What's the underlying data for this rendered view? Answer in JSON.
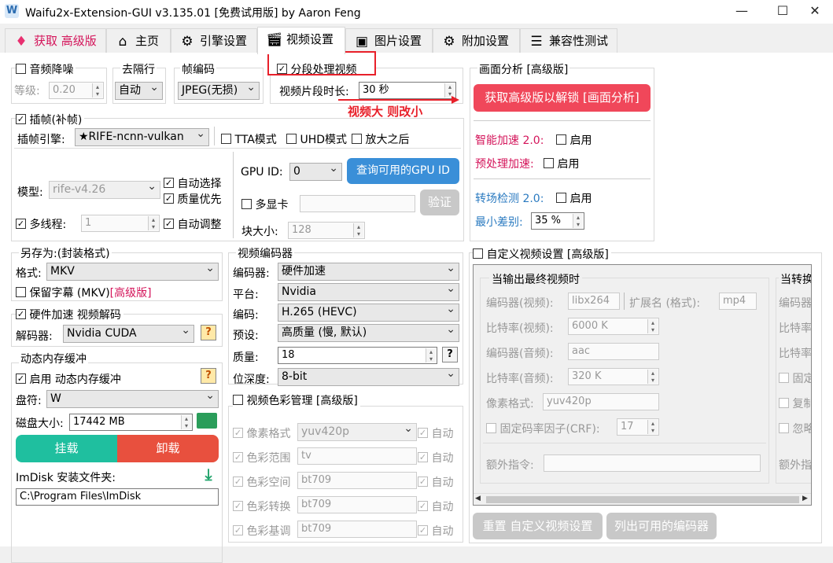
{
  "window": {
    "title": "Waifu2x-Extension-GUI v3.135.01 [免费试用版] by Aaron Feng",
    "app_icon": "W",
    "minimize": "—",
    "maximize": "☐",
    "close": "✕"
  },
  "tabs": [
    {
      "label": "获取 高级版",
      "icon": "diamond-icon"
    },
    {
      "label": "主页",
      "icon": "home-icon"
    },
    {
      "label": "引擎设置",
      "icon": "gear-icon"
    },
    {
      "label": "视频设置",
      "icon": "clapperboard-icon"
    },
    {
      "label": "图片设置",
      "icon": "image-icon"
    },
    {
      "label": "附加设置",
      "icon": "gear-icon"
    },
    {
      "label": "兼容性测试",
      "icon": "checklist-icon"
    }
  ],
  "denoise": {
    "title": "音频降噪",
    "level_label": "等级:",
    "level_value": "0.20"
  },
  "deinterlace": {
    "title": "去隔行",
    "value": "自动"
  },
  "frame_codec": {
    "title": "帧编码",
    "value": "JPEG(无损)"
  },
  "segment": {
    "title": "分段处理视频",
    "checked": true,
    "len_label": "视频片段时长:",
    "len_value": "30 秒",
    "annotation": "视频大 则改小"
  },
  "interp": {
    "title": "插帧(补帧)",
    "engine_label": "插帧引擎:",
    "engine_value": "★RIFE-ncnn-vulkan",
    "tta": "TTA模式",
    "uhd": "UHD模式",
    "after": "放大之后",
    "model_label": "模型:",
    "model_value": "rife-v4.26",
    "auto_select": "自动选择",
    "quality_first": "质量优先",
    "auto_adjust": "自动调整",
    "multithread_label": "多线程:",
    "multithread_value": "1",
    "gpu_label": "GPU ID:",
    "gpu_value": "0",
    "query_gpu": "查询可用的GPU ID",
    "multi_gpu": "多显卡",
    "verify": "验证",
    "tile_label": "块大小:",
    "tile_value": "128"
  },
  "analysis": {
    "title": "画面分析 [高级版]",
    "unlock": "获取高级版以解锁 [画面分析]",
    "smart_accel": "智能加速 2.0:",
    "pre_accel": "预处理加速:",
    "scene_detect": "转场检测 2.0:",
    "enable": "启用",
    "min_diff_label": "最小差别:",
    "min_diff_value": "35 %"
  },
  "save_as": {
    "title": "另存为:(封装格式)",
    "format_label": "格式:",
    "format_value": "MKV",
    "keep_subs": "保留字幕 (MKV)",
    "premium": "[高级版]"
  },
  "hwdecode": {
    "title": "硬件加速 视频解码",
    "decoder_label": "解码器:",
    "decoder_value": "Nvidia CUDA"
  },
  "ramcache": {
    "title": "动态内存缓冲",
    "enable": "启用 动态内存缓冲",
    "drive_label": "盘符:",
    "drive_value": "W",
    "size_label": "磁盘大小:",
    "size_value": "17442 MB",
    "mount": "挂载",
    "unmount": "卸载",
    "imdisk_label": "ImDisk 安装文件夹:",
    "imdisk_path": "C:\\Program Files\\ImDisk"
  },
  "encoder": {
    "title": "视频编码器",
    "encoder_label": "编码器:",
    "encoder_value": "硬件加速",
    "platform_label": "平台:",
    "platform_value": "Nvidia",
    "codec_label": "编码:",
    "codec_value": "H.265 (HEVC)",
    "preset_label": "预设:",
    "preset_value": "高质量 (慢, 默认)",
    "quality_label": "质量:",
    "quality_value": "18",
    "depth_label": "位深度:",
    "depth_value": "8-bit"
  },
  "color": {
    "title": "视频色彩管理 [高级版]",
    "auto": "自动",
    "rows": [
      {
        "label": "像素格式",
        "value": "yuv420p"
      },
      {
        "label": "色彩范围",
        "value": "tv"
      },
      {
        "label": "色彩空间",
        "value": "bt709"
      },
      {
        "label": "色彩转换",
        "value": "bt709"
      },
      {
        "label": "色彩基调",
        "value": "bt709"
      }
    ]
  },
  "custom": {
    "title": "自定义视频设置 [高级版]",
    "group1": "当输出最终视频时",
    "group2": "当转换",
    "venc_label": "编码器(视频):",
    "venc_value": "libx264",
    "ext_label": "扩展名 (格式):",
    "ext_value": "mp4",
    "vbr_label": "比特率(视频):",
    "vbr_value": "6000 K",
    "aenc_label": "编码器(音频):",
    "aenc_value": "aac",
    "abr_label": "比特率(音频):",
    "abr_value": "320 K",
    "pix_label": "像素格式:",
    "pix_value": "yuv420p",
    "crf_label": "固定码率因子(CRF):",
    "crf_value": "17",
    "extra_label": "额外指令:",
    "r_encoder": "编码器",
    "r_bitrate1": "比特率",
    "r_bitrate2": "比特率",
    "r_fixed": "固定",
    "r_copy": "复制",
    "r_ignore": "忽略",
    "r_extra": "额外指",
    "reset": "重置 自定义视频设置",
    "list": "列出可用的编码器"
  },
  "colors": {
    "teal": "#1fbf9f",
    "red": "#e8503e",
    "blue_btn": "#3a8fd8",
    "pink_btn": "#f0475a",
    "annot_red": "#e8202a"
  }
}
